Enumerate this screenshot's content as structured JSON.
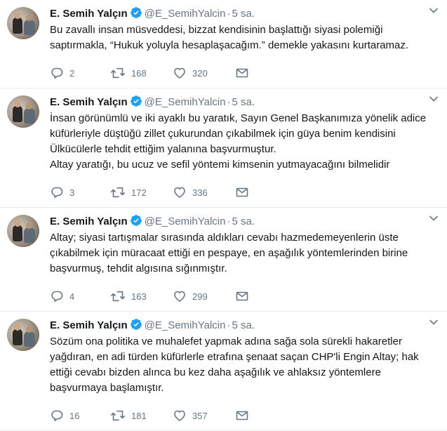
{
  "tweets": [
    {
      "name": "E. Semih Yalçın",
      "handle": "@E_SemihYalcin",
      "separator": "·",
      "time": "5 sa.",
      "text": "Bu zavallı insan müsveddesi, bizzat kendisinin başlattığı siyasi polemiği\nsaptırmakla, “Hukuk yoluyla hesaplaşacağım.” demekle yakasını kurtaramaz.",
      "replies": "2",
      "retweets": "168",
      "likes": "320"
    },
    {
      "name": "E. Semih Yalçın",
      "handle": "@E_SemihYalcin",
      "separator": "·",
      "time": "5 sa.",
      "text": "İnsan görünümlü ve iki ayaklı bu yaratık, Sayın Genel Başkanımıza yönelik adice\nküfürleriyle düştüğü zillet çukurundan çıkabilmek için güya benim kendisini\nÜlkücülerle tehdit ettiğim yalanına başvurmuştur.\nAltay yaratığı, bu ucuz ve sefil yöntemi kimsenin yutmayacağını bilmelidir",
      "replies": "3",
      "retweets": "172",
      "likes": "336"
    },
    {
      "name": "E. Semih Yalçın",
      "handle": "@E_SemihYalcin",
      "separator": "·",
      "time": "5 sa.",
      "text": "Altay; siyasi tartışmalar sırasında aldıkları cevabı hazmedemeyenlerin üste\nçıkabilmek için müracaat ettiği en pespaye, en aşağılık yöntemlerinden birine\nbaşvurmuş, tehdit algısına sığınmıştır.",
      "replies": "4",
      "retweets": "163",
      "likes": "299"
    },
    {
      "name": "E. Semih Yalçın",
      "handle": "@E_SemihYalcin",
      "separator": "·",
      "time": "5 sa.",
      "text": "Sözüm ona politika ve muhalefet yapmak adına sağa sola sürekli hakaretler\nyağdıran, en adi türden küfürlerle etrafına şenaat saçan CHP'li Engin Altay; hak\nettiği cevabı bizden alınca bu kez daha aşağılık ve ahlaksız yöntemlere\nbaşvurmaya başlamıştır.",
      "replies": "16",
      "retweets": "181",
      "likes": "357"
    }
  ],
  "icons": {
    "verified": "verified-badge-icon",
    "caret": "chevron-down-icon",
    "reply": "reply-icon",
    "retweet": "retweet-icon",
    "like": "heart-icon",
    "dm": "envelope-icon"
  },
  "colors": {
    "verified": "#1da1f2",
    "icon": "#657786",
    "text": "#14171a",
    "divider": "#e6ecf0"
  }
}
